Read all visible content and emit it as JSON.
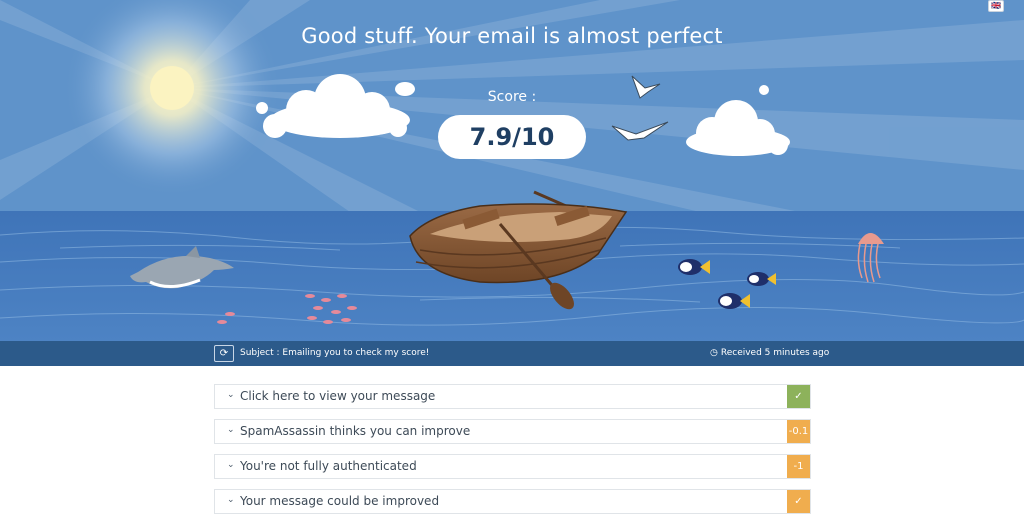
{
  "hero": {
    "headline": "Good stuff. Your email is almost perfect",
    "score_label": "Score :",
    "score_value": "7.9/10"
  },
  "language": {
    "flag_icon": "uk-flag-icon",
    "flag_text": "🇬🇧"
  },
  "subject_bar": {
    "refresh_icon": "refresh-icon",
    "refresh_glyph": "⟳",
    "subject": "Subject : Emailing you to check my score!",
    "clock_glyph": "◷",
    "received": "Received 5 minutes ago"
  },
  "results": [
    {
      "label": "Click here to view your message",
      "badge": "✓",
      "status": "good",
      "color": "#8db25b"
    },
    {
      "label": "SpamAssassin thinks you can improve",
      "badge": "-0.1",
      "status": "warning",
      "color": "#f0ad4e"
    },
    {
      "label": "You're not fully authenticated",
      "badge": "-1",
      "status": "warning",
      "color": "#f0ad4e"
    },
    {
      "label": "Your message could be improved",
      "badge": "✓",
      "status": "warning",
      "color": "#f0ad4e"
    }
  ],
  "chevron_glyph": "⌄"
}
